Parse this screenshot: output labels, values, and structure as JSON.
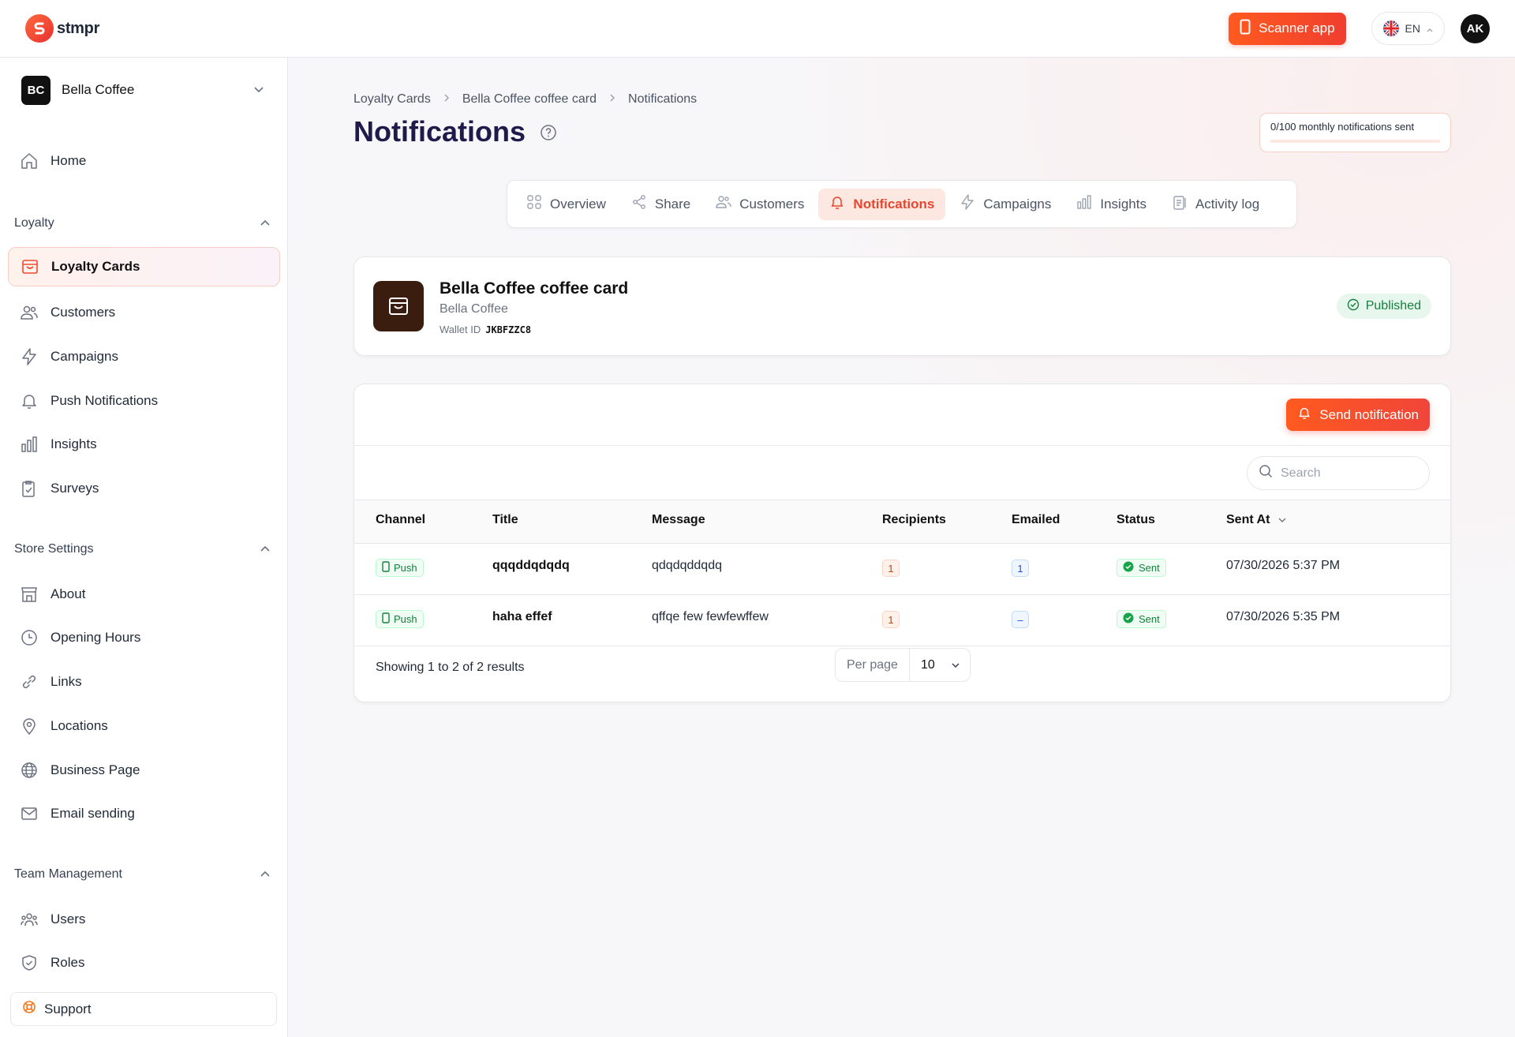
{
  "app": {
    "logo_text": "stmpr"
  },
  "topbar": {
    "scanner_label": "Scanner app",
    "language": "EN",
    "user_initials": "AK"
  },
  "sidebar": {
    "org": {
      "initials": "BC",
      "name": "Bella Coffee"
    },
    "home": "Home",
    "loyalty_section": "Loyalty",
    "loyalty_items": [
      "Loyalty Cards",
      "Customers",
      "Campaigns",
      "Push Notifications",
      "Insights",
      "Surveys"
    ],
    "store_section": "Store Settings",
    "store_items": [
      "About",
      "Opening Hours",
      "Links",
      "Locations",
      "Business Page",
      "Email sending"
    ],
    "team_section": "Team Management",
    "team_items": [
      "Users",
      "Roles"
    ],
    "support": "Support"
  },
  "breadcrumb": [
    "Loyalty Cards",
    "Bella Coffee coffee card",
    "Notifications"
  ],
  "page_title": "Notifications",
  "quota": {
    "label": "0/100 monthly notifications sent",
    "sent": 0,
    "limit": 100
  },
  "tabs": [
    "Overview",
    "Share",
    "Customers",
    "Notifications",
    "Campaigns",
    "Insights",
    "Activity log"
  ],
  "active_tab": "Notifications",
  "card": {
    "title": "Bella Coffee coffee card",
    "subtitle": "Bella Coffee",
    "wallet_label": "Wallet ID",
    "wallet_id": "JKBFZZC8",
    "status": "Published"
  },
  "table": {
    "send_label": "Send notification",
    "search_placeholder": "Search",
    "columns": [
      "Channel",
      "Title",
      "Message",
      "Recipients",
      "Emailed",
      "Status",
      "Sent At"
    ],
    "rows": [
      {
        "channel": "Push",
        "title": "qqqddqdqdq",
        "message": "qdqdqddqdq",
        "recipients": "1",
        "emailed": "1",
        "status": "Sent",
        "sent_at": "07/30/2026 5:37 PM"
      },
      {
        "channel": "Push",
        "title": "haha effef",
        "message": "qffqe few fewfewffew",
        "recipients": "1",
        "emailed": "–",
        "status": "Sent",
        "sent_at": "07/30/2026 5:35 PM"
      }
    ],
    "footer": "Showing 1 to 2 of 2 results",
    "per_page_label": "Per page",
    "per_page_value": "10"
  },
  "colors": {
    "accent": "#f04a2f",
    "brand_dark": "#1e1b4b",
    "success": "#15803d"
  }
}
